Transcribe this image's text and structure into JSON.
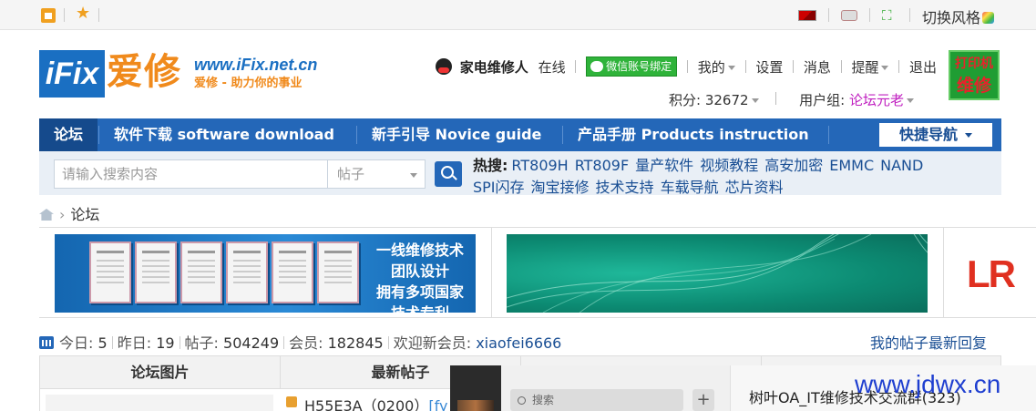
{
  "topbar": {
    "switch_style": "切换风格"
  },
  "logo": {
    "brand_en": "iFix",
    "brand_cn": "爱修",
    "url": "www.iFix.net.cn",
    "slogan": "爱修 - 助力你的事业"
  },
  "user": {
    "name": "家电维修人",
    "status": "在线",
    "wechat_bind": "微信账号绑定",
    "menu": [
      "我的",
      "设置",
      "消息",
      "提醒",
      "退出"
    ],
    "points_label": "积分:",
    "points_value": "32672",
    "group_label": "用户组:",
    "group_value": "论坛元老"
  },
  "printer_ad": {
    "line1": "打印机",
    "line2": "维修"
  },
  "nav": {
    "items": [
      "论坛",
      "软件下载 software download",
      "新手引导 Novice guide",
      "产品手册 Products instruction"
    ],
    "quick_nav": "快捷导航"
  },
  "search": {
    "placeholder": "请输入搜索内容",
    "type_selected": "帖子",
    "hot_label": "热搜:",
    "hot_links": [
      "RT809H",
      "RT809F",
      "量产软件",
      "视频教程",
      "高安加密",
      "EMMC",
      "NAND",
      "SPI闪存",
      "淘宝接修",
      "技术支持",
      "车载导航",
      "芯片资料"
    ]
  },
  "breadcrumb": {
    "current": "论坛"
  },
  "banners": {
    "cert_ad_lines": [
      "一线维修技术",
      "团队设计",
      "拥有多项国家",
      "技术专利"
    ],
    "third_ad_text": "LR"
  },
  "stats": {
    "today_label": "今日:",
    "today_value": "5",
    "yesterday_label": "昨日:",
    "yesterday_value": "19",
    "posts_label": "帖子:",
    "posts_value": "504249",
    "members_label": "会员:",
    "members_value": "182845",
    "welcome_label": "欢迎新会员:",
    "welcome_member": "xiaofei6666",
    "my_posts": "我的帖子",
    "latest_reply": "最新回复"
  },
  "table": {
    "headers": [
      "论坛图片",
      "最新帖子"
    ],
    "first_thread": "H55E3A（0200）",
    "first_thread_tag": "[fy"
  },
  "popup": {
    "search_placeholder": "搜索",
    "plus": "+",
    "chat_title": "树叶OA_IT维修技术交流群(323)"
  },
  "watermark": "www.jdwx.cn",
  "colors": {
    "primary": "#2467b8",
    "accent_orange": "#f08a1c",
    "usergroup": "#c020c0"
  }
}
